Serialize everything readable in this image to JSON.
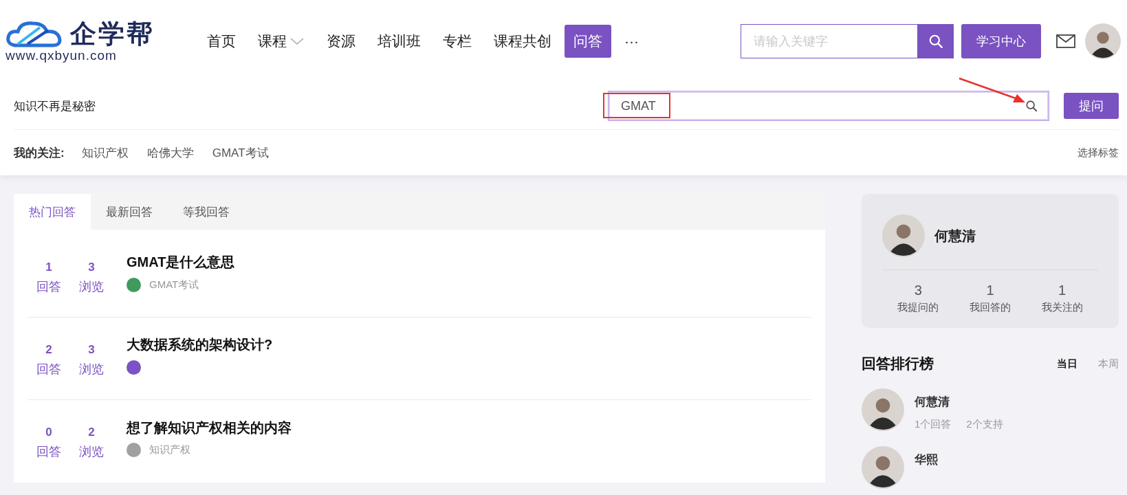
{
  "header": {
    "logo": {
      "name": "企学帮",
      "url": "www.qxbyun.com"
    },
    "nav": [
      {
        "label": "首页",
        "selected": false,
        "has_menu": false
      },
      {
        "label": "课程",
        "selected": false,
        "has_menu": true
      },
      {
        "label": "资源",
        "selected": false,
        "has_menu": false
      },
      {
        "label": "培训班",
        "selected": false,
        "has_menu": false
      },
      {
        "label": "专栏",
        "selected": false,
        "has_menu": false
      },
      {
        "label": "课程共创",
        "selected": false,
        "has_menu": false
      },
      {
        "label": "问答",
        "selected": true,
        "has_menu": false
      },
      {
        "label": "···",
        "selected": false,
        "has_menu": false
      }
    ],
    "search": {
      "placeholder": "请输入关键字"
    },
    "learning_center": "学习中心"
  },
  "subheader": {
    "slogan": "知识不再是秘密",
    "question_search": {
      "value": "GMAT"
    },
    "ask_button": "提问",
    "follow_label": "我的关注:",
    "follows": [
      "知识产权",
      "哈佛大学",
      "GMAT考试"
    ],
    "choose_tags": "选择标签"
  },
  "annotations": [
    {
      "kind": "highlight-box"
    },
    {
      "kind": "arrow"
    }
  ],
  "tabs": [
    {
      "label": "热门回答",
      "selected": true
    },
    {
      "label": "最新回答",
      "selected": false
    },
    {
      "label": "等我回答",
      "selected": false
    }
  ],
  "questions": [
    {
      "answers": "1",
      "answers_label": "回答",
      "views": "3",
      "views_label": "浏览",
      "title": "GMAT是什么意思",
      "tag": {
        "label": "GMAT考试",
        "color": "#3f9a5e"
      }
    },
    {
      "answers": "2",
      "answers_label": "回答",
      "views": "3",
      "views_label": "浏览",
      "title": "大数据系统的架构设计?",
      "tag": {
        "color": "#7b52c7"
      }
    },
    {
      "answers": "0",
      "answers_label": "回答",
      "views": "2",
      "views_label": "浏览",
      "title": "想了解知识产权相关的内容",
      "tag": {
        "label": "知识产权",
        "color": "#a0a0a0"
      }
    }
  ],
  "profile": {
    "name": "何慧清",
    "stats": [
      {
        "value": "3",
        "label": "我提问的"
      },
      {
        "value": "1",
        "label": "我回答的"
      },
      {
        "value": "1",
        "label": "我关注的"
      }
    ]
  },
  "ranking": {
    "title": "回答排行榜",
    "periods": [
      {
        "label": "当日",
        "selected": true
      },
      {
        "label": "本周",
        "selected": false
      }
    ],
    "users": [
      {
        "name": "何慧清",
        "answers": "1个回答",
        "supports": "2个支持"
      },
      {
        "name": "华熙"
      }
    ]
  }
}
